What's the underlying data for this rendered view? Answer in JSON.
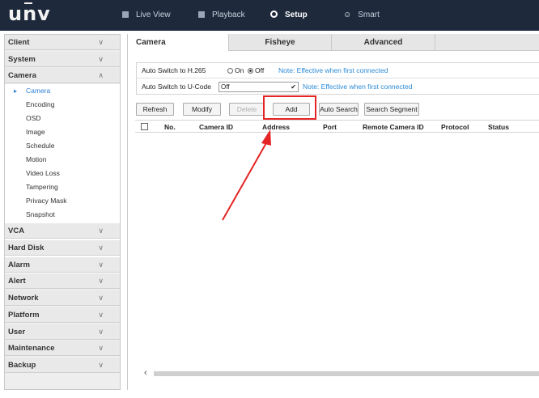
{
  "brand": {
    "logo_text": "unv"
  },
  "nav": [
    {
      "label": "Live View",
      "icon": "monitor-icon"
    },
    {
      "label": "Playback",
      "icon": "film-icon"
    },
    {
      "label": "Setup",
      "icon": "gear-icon"
    },
    {
      "label": "Smart",
      "icon": "person-icon"
    }
  ],
  "sidebar": {
    "categories": [
      {
        "label": "Client"
      },
      {
        "label": "System"
      },
      {
        "label": "Camera",
        "expanded": true
      },
      {
        "label": "VCA"
      },
      {
        "label": "Hard Disk"
      },
      {
        "label": "Alarm"
      },
      {
        "label": "Alert"
      },
      {
        "label": "Network"
      },
      {
        "label": "Platform"
      },
      {
        "label": "User"
      },
      {
        "label": "Maintenance"
      },
      {
        "label": "Backup"
      }
    ],
    "camera_items": [
      "Camera",
      "Encoding",
      "OSD",
      "Image",
      "Schedule",
      "Motion",
      "Video Loss",
      "Tampering",
      "Privacy Mask",
      "Snapshot"
    ]
  },
  "tabs": [
    "Camera",
    "Fisheye",
    "Advanced"
  ],
  "settings": {
    "h265": {
      "label": "Auto Switch to H.265",
      "on": "On",
      "off": "Off",
      "selected": "Off",
      "note": "Note: Effective when first connected"
    },
    "ucode": {
      "label": "Auto Switch to U-Code",
      "value": "Off",
      "note": "Note: Effective when first connected"
    }
  },
  "toolbar": {
    "refresh": "Refresh",
    "modify": "Modify",
    "delete": "Delete",
    "add": "Add",
    "auto_search": "Auto Search",
    "search_segment": "Search Segment"
  },
  "table": {
    "columns": [
      "No.",
      "Camera ID",
      "Address",
      "Port",
      "Remote Camera ID",
      "Protocol",
      "Status"
    ]
  },
  "colors": {
    "topbar": "#1e2a3c",
    "accent": "#2b7fd8",
    "highlight": "#e52525"
  }
}
